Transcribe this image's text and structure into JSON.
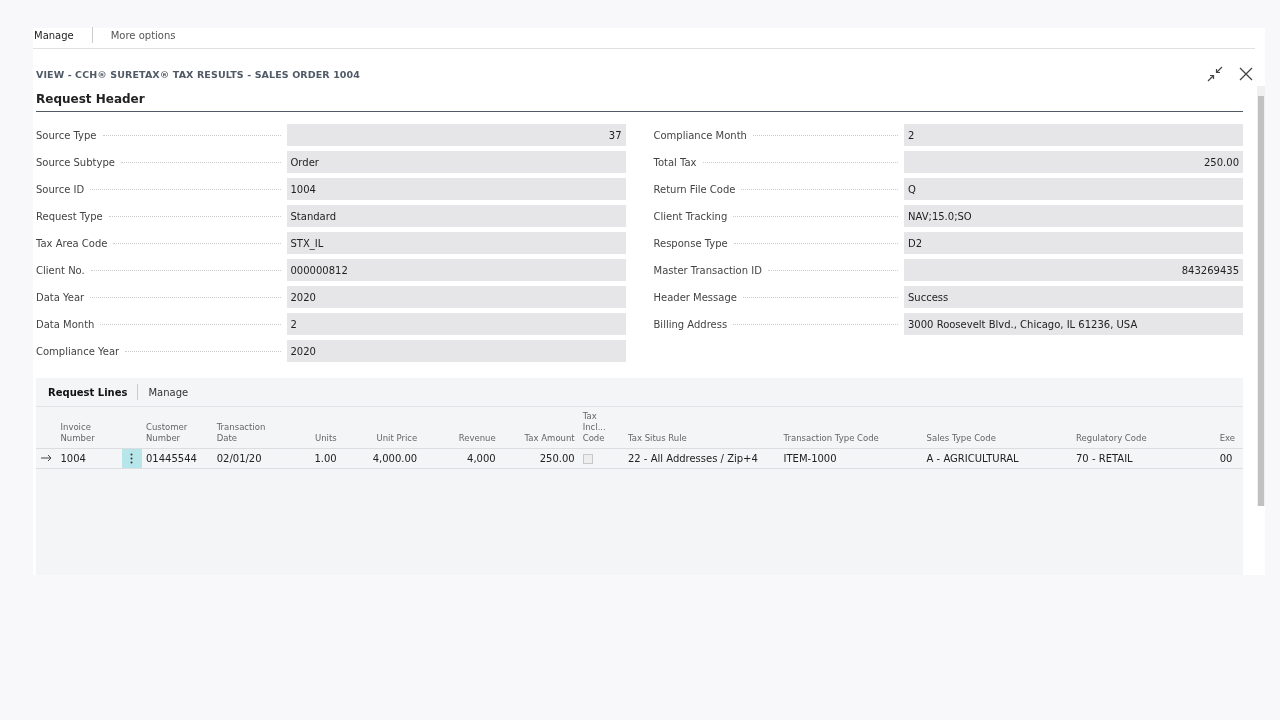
{
  "action_bar": [
    {
      "label": "Manage"
    },
    {
      "label": "More options"
    }
  ],
  "page_title": "VIEW - CCH® SURETAX® TAX RESULTS - SALES ORDER 1004",
  "section_title": "Request Header",
  "fields_left": [
    {
      "label": "Source Type",
      "value": "37",
      "numeric": true
    },
    {
      "label": "Source Subtype",
      "value": "Order",
      "numeric": false
    },
    {
      "label": "Source ID",
      "value": "1004",
      "numeric": false
    },
    {
      "label": "Request Type",
      "value": "Standard",
      "numeric": false
    },
    {
      "label": "Tax Area Code",
      "value": "STX_IL",
      "numeric": false
    },
    {
      "label": "Client No.",
      "value": "000000812",
      "numeric": false
    },
    {
      "label": "Data Year",
      "value": "2020",
      "numeric": false
    },
    {
      "label": "Data Month",
      "value": "2",
      "numeric": false
    },
    {
      "label": "Compliance Year",
      "value": "2020",
      "numeric": false
    }
  ],
  "fields_right": [
    {
      "label": "Compliance Month",
      "value": "2",
      "numeric": false
    },
    {
      "label": "Total Tax",
      "value": "250.00",
      "numeric": true
    },
    {
      "label": "Return File Code",
      "value": "Q",
      "numeric": false
    },
    {
      "label": "Client Tracking",
      "value": "NAV;15.0;SO",
      "numeric": false
    },
    {
      "label": "Response Type",
      "value": "D2",
      "numeric": false
    },
    {
      "label": "Master Transaction ID",
      "value": "843269435",
      "numeric": true
    },
    {
      "label": "Header Message",
      "value": "Success",
      "numeric": false
    },
    {
      "label": "Billing Address",
      "value": "3000 Roosevelt Blvd., Chicago, IL 61236, USA",
      "numeric": false
    }
  ],
  "lines": {
    "tabs": [
      {
        "label": "Request Lines",
        "selected": true
      },
      {
        "label": "Manage",
        "selected": false
      }
    ],
    "columns": [
      {
        "label": "Invoice Number",
        "numeric": false
      },
      {
        "label": "Customer Number",
        "numeric": false
      },
      {
        "label": "Transaction Date",
        "numeric": false
      },
      {
        "label": "Units",
        "numeric": true
      },
      {
        "label": "Unit Price",
        "numeric": true
      },
      {
        "label": "Revenue",
        "numeric": true
      },
      {
        "label": "Tax Amount",
        "numeric": true
      },
      {
        "label": "Tax Incl... Code",
        "numeric": false
      },
      {
        "label": "Tax Situs Rule",
        "numeric": false
      },
      {
        "label": "Transaction Type Code",
        "numeric": false
      },
      {
        "label": "Sales Type Code",
        "numeric": false
      },
      {
        "label": "Regulatory Code",
        "numeric": false
      },
      {
        "label": "Exe",
        "numeric": false
      }
    ],
    "rows": [
      {
        "current": true,
        "cells": [
          {
            "kind": "text",
            "value": "1004"
          },
          {
            "kind": "text",
            "value": "01445544"
          },
          {
            "kind": "text",
            "value": "02/01/20"
          },
          {
            "kind": "text",
            "value": "1.00"
          },
          {
            "kind": "text",
            "value": "4,000.00"
          },
          {
            "kind": "text",
            "value": "4,000"
          },
          {
            "kind": "text",
            "value": "250.00"
          },
          {
            "kind": "checkbox",
            "checked": false
          },
          {
            "kind": "text",
            "value": "22 - All Addresses / Zip+4"
          },
          {
            "kind": "text",
            "value": "ITEM-1000"
          },
          {
            "kind": "text",
            "value": "A - AGRICULTURAL"
          },
          {
            "kind": "text",
            "value": "70 - RETAIL"
          },
          {
            "kind": "text",
            "value": "00"
          }
        ]
      }
    ]
  }
}
